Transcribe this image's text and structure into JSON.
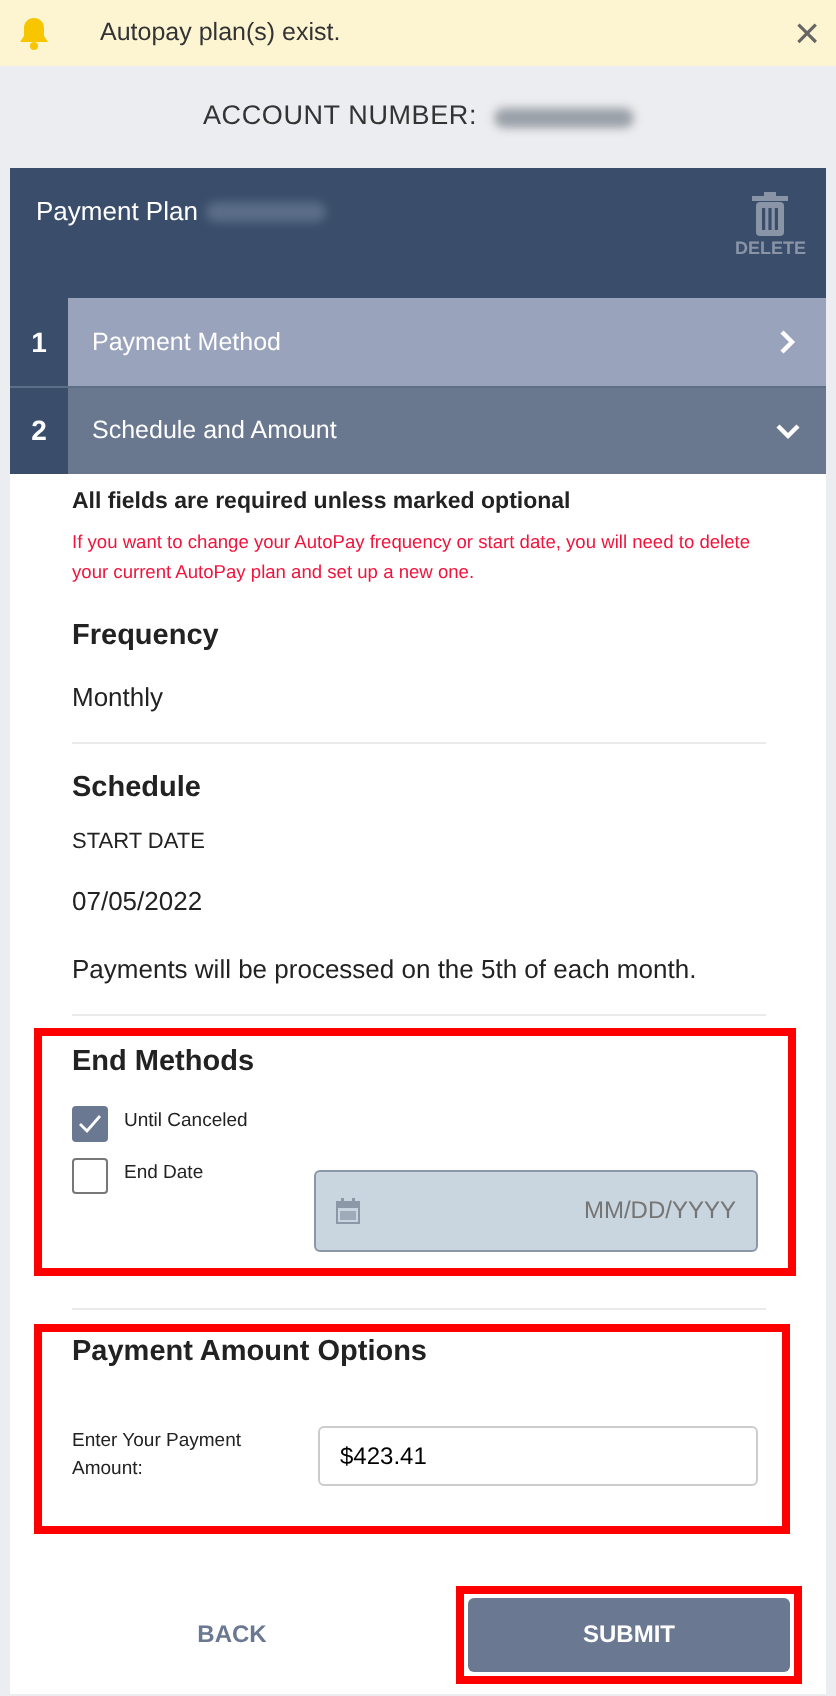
{
  "alert": {
    "text": "Autopay plan(s) exist.",
    "close": "×"
  },
  "account": {
    "label": "ACCOUNT NUMBER:",
    "redacted": true
  },
  "plan": {
    "title": "Payment Plan",
    "redacted": true,
    "delete_label": "DELETE"
  },
  "steps": [
    {
      "number": "1",
      "label": "Payment Method",
      "expanded": false
    },
    {
      "number": "2",
      "label": "Schedule and Amount",
      "expanded": true
    }
  ],
  "form": {
    "required_note": "All fields are required unless marked optional",
    "warning": "If you want to change your AutoPay frequency or start date, you will need to delete your current AutoPay plan and set up a new one.",
    "frequency": {
      "heading": "Frequency",
      "value": "Monthly"
    },
    "schedule": {
      "heading": "Schedule",
      "start_label": "START DATE",
      "start_value": "07/05/2022",
      "note": "Payments will be processed on the 5th of each month."
    },
    "end_methods": {
      "heading": "End Methods",
      "highlighted": true,
      "options": [
        {
          "label": "Until Canceled",
          "checked": true,
          "kind": "plain"
        },
        {
          "label": "End Date",
          "checked": false,
          "kind": "date",
          "placeholder": "MM/DD/YYYY",
          "disabled": true
        }
      ]
    },
    "amount": {
      "heading": "Payment Amount Options",
      "highlighted": true,
      "label": "Enter Your Payment Amount:",
      "value": "$423.41"
    }
  },
  "buttons": [
    {
      "label": "BACK",
      "kind": "link",
      "highlighted": false
    },
    {
      "label": "SUBMIT",
      "kind": "primary",
      "highlighted": true
    }
  ]
}
